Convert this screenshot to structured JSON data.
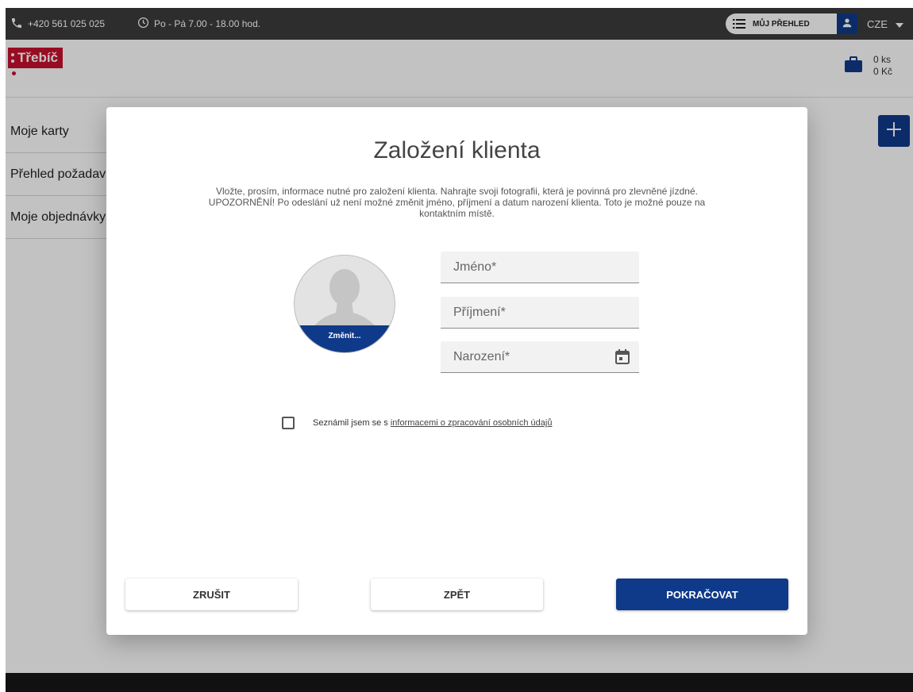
{
  "topbar": {
    "phone": "+420 561 025 025",
    "hours": "Po - Pá 7.00 - 18.00 hod.",
    "overview_label": "MŮJ PŘEHLED",
    "language": "CZE"
  },
  "header": {
    "logo_text": "Třebíč",
    "cart_count": "0 ks",
    "cart_total": "0 Kč"
  },
  "sidebar": {
    "items": [
      {
        "label": "Moje karty"
      },
      {
        "label": "Přehled požadavků"
      },
      {
        "label": "Moje objednávky"
      }
    ]
  },
  "modal": {
    "title": "Založení klienta",
    "description": "Vložte, prosím, informace nutné pro založení klienta. Nahrajte svoji fotografii, která je povinná pro zlevněné jízdné. UPOZORNĚNÍ! Po odeslání už není možné změnit jméno, příjmení a datum narození klienta. Toto je možné pouze na kontaktním místě.",
    "avatar_change": "Změnit...",
    "fields": {
      "first_name": {
        "placeholder": "Jméno*",
        "value": ""
      },
      "last_name": {
        "placeholder": "Příjmení*",
        "value": ""
      },
      "birth_date": {
        "placeholder": "Narození*",
        "value": ""
      }
    },
    "consent": {
      "text": "Seznámil jsem se s",
      "link": "informacemi o zpracování osobních údajů",
      "checked": false
    },
    "buttons": {
      "cancel": "ZRUŠIT",
      "back": "ZPĚT",
      "continue": "POKRAČOVAT"
    }
  },
  "colors": {
    "brand_blue": "#0f3a8a",
    "logo_red": "#c8102e",
    "topbar": "#3c3c3c"
  },
  "icons": [
    "phone-icon",
    "clock-icon",
    "list-icon",
    "user-icon",
    "chevron-down-icon",
    "briefcase-icon",
    "plus-icon",
    "calendar-icon",
    "avatar-placeholder-icon"
  ]
}
